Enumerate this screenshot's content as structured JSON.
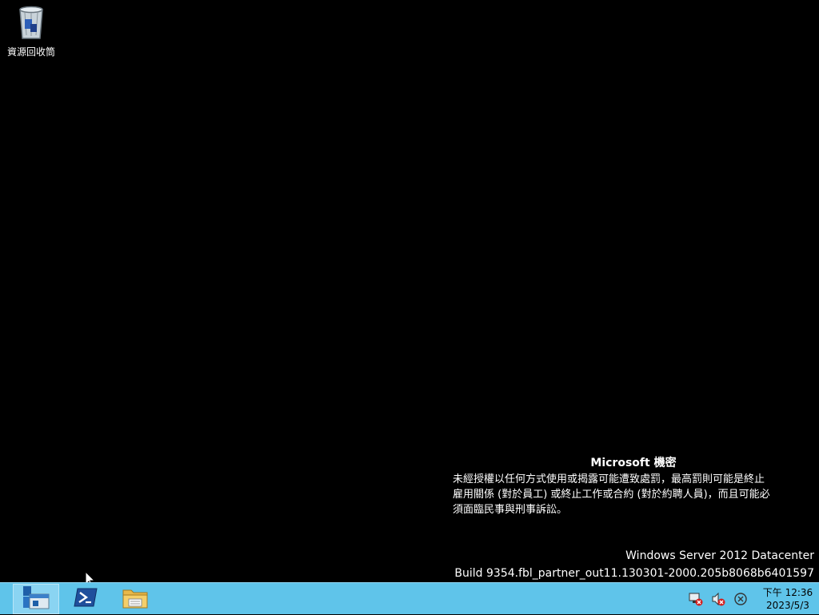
{
  "desktop": {
    "icons": [
      {
        "label": "資源回收筒",
        "icon": "recycle-bin-icon"
      }
    ],
    "watermark": {
      "title": "Microsoft 機密",
      "lines": [
        "未經授權以任何方式使用或揭露可能遭致處罰，最高罰則可能是終止",
        "雇用關係 (對於員工) 或終止工作或合約 (對於約聘人員)，而且可能必",
        "須面臨民事與刑事訴訟。"
      ]
    },
    "build": {
      "edition": "Windows Server 2012 Datacenter",
      "build": "Build 9354.fbl_partner_out11.130301-2000.205b8068b6401597"
    }
  },
  "taskbar": {
    "color": "#5fc4ea",
    "pinned": [
      {
        "name": "server-manager",
        "icon": "server-manager-icon",
        "active": true
      },
      {
        "name": "powershell",
        "icon": "powershell-icon",
        "active": false
      },
      {
        "name": "file-explorer",
        "icon": "folder-icon",
        "active": false
      }
    ],
    "tray": {
      "icons": [
        "network-error-icon",
        "volume-muted-icon",
        "action-center-icon"
      ],
      "time": "下午 12:36",
      "date": "2023/5/3"
    }
  }
}
